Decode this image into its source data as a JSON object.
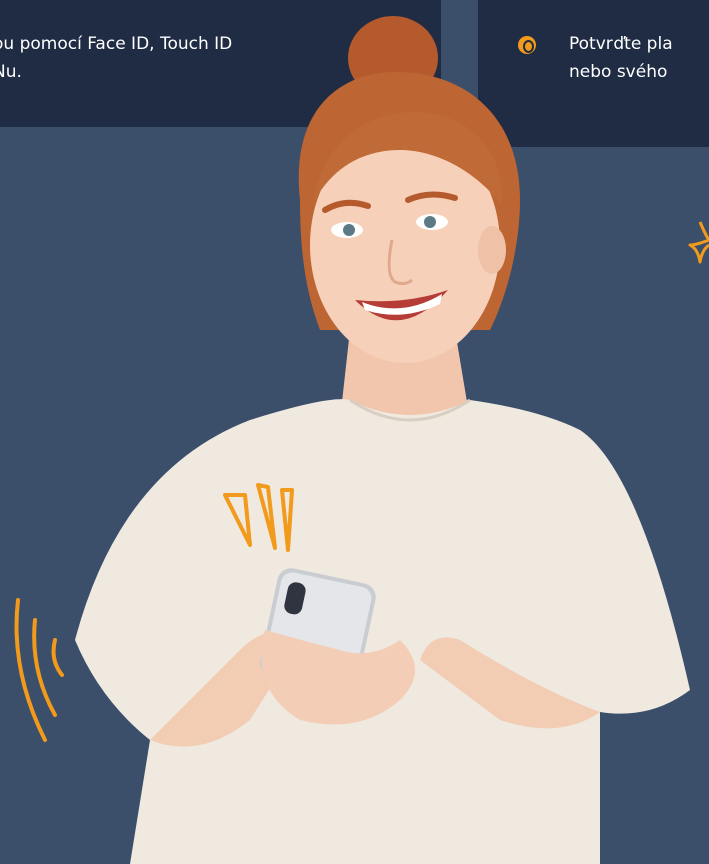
{
  "cards": {
    "left": {
      "line1": "ou pomocí Face ID, Touch ID",
      "line2": "Nu."
    },
    "right": {
      "bullet_icon": "orange-circle-icon",
      "line1": "Potvrďte pla",
      "line2": "nebo svého"
    }
  },
  "colors": {
    "background": "#3b4f6b",
    "card": "#1f2c43",
    "accent": "#f29a1b",
    "text": "#ffffff"
  }
}
